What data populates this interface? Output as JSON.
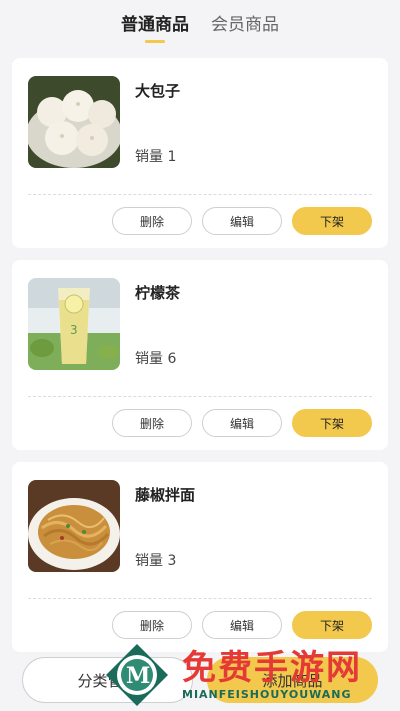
{
  "tabs": [
    {
      "label": "普通商品",
      "active": true
    },
    {
      "label": "会员商品",
      "active": false
    }
  ],
  "products": [
    {
      "name": "大包子",
      "sales": "销量 1",
      "image": "steamed-buns-image"
    },
    {
      "name": "柠檬茶",
      "sales": "销量 6",
      "image": "lemon-tea-image"
    },
    {
      "name": "藤椒拌面",
      "sales": "销量 3",
      "image": "noodles-image"
    }
  ],
  "actions": {
    "delete_label": "删除",
    "edit_label": "编辑",
    "offshelf_label": "下架"
  },
  "bottom": {
    "category_label": "分类管理",
    "add_label": "添加商品"
  },
  "watermark": {
    "title": "免费手游网",
    "subtitle": "MIANFEISHOUYOUWANG"
  },
  "colors": {
    "accent": "#f2c94c",
    "background": "#f4f4f6",
    "watermark_red": "#e53935",
    "watermark_green": "#1a6b5a"
  }
}
